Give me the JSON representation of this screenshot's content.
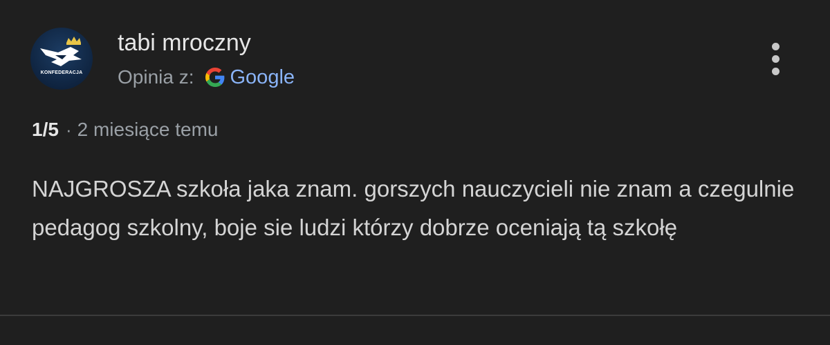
{
  "review": {
    "author_name": "tabi mroczny",
    "avatar_text": "KONFEDERACJA",
    "source_label": "Opinia z:",
    "source_name": "Google",
    "rating": "1/5",
    "separator": "·",
    "date": "2 miesiące temu",
    "text": "NAJGROSZA szkoła jaka znam. gorszych nauczycieli nie znam a czegulnie pedagog szkolny, boje sie ludzi którzy dobrze oceniają tą szkołę"
  },
  "icons": {
    "avatar": "konfederacja-logo",
    "source": "google-g-icon",
    "menu": "more-vert-icon"
  },
  "colors": {
    "background": "#1f1f1f",
    "primary_text": "#e6e6e6",
    "secondary_text": "#9aa0a6",
    "link": "#8ab4f8",
    "divider": "#3c3c3c"
  }
}
